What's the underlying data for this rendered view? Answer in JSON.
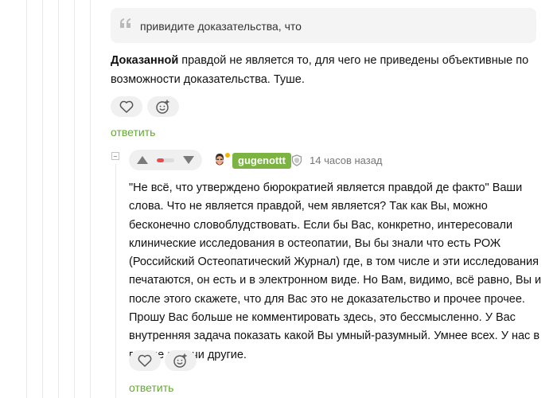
{
  "quote": {
    "text": "привидите доказательства, что"
  },
  "comment1": {
    "bold_lead": "Доказанной",
    "text": " правдой не является то, для чего не приведены объективные по возможности доказательства. Туше.",
    "reply_label": "ответить"
  },
  "comment2": {
    "username": "gugenottt",
    "timestamp": "14 часов назад",
    "rating_fraction": 0.4,
    "text": "\"Не всё, что утверждено бюрократией является правдой де факто\" Ваши слова. Что не является правдой, чем является? Так как Вы, можно бесконечно словоблудствовать. Если бы Вас, конкретно, интересовали клинические исследования в остеопатии, Вы бы знали что есть РОЖ (Российский Остеопатический Журнал) где, в том числе и эти исследования печатаются, он есть и в электронном виде. Но Вам, видимо, всё равно, Вы и после этого скажете, что для Вас это не доказательство и прочее прочее. Прошу Вас больше не комментировать здесь, это бессмысленно. У Вас внутренняя задача показать какой Вы умный-разумный. Умнее всех. У нас в группе задачи другие.",
    "reply_label": "ответить"
  },
  "colors": {
    "accent_green": "#64a832",
    "username_bg": "#7cb342",
    "rating_red": "#e84d4d",
    "online_dot": "#f5b400"
  },
  "icons": [
    "quote-icon",
    "heart-icon",
    "emoji-add-icon",
    "upvote-icon",
    "downvote-icon",
    "avatar",
    "shield-icon"
  ]
}
